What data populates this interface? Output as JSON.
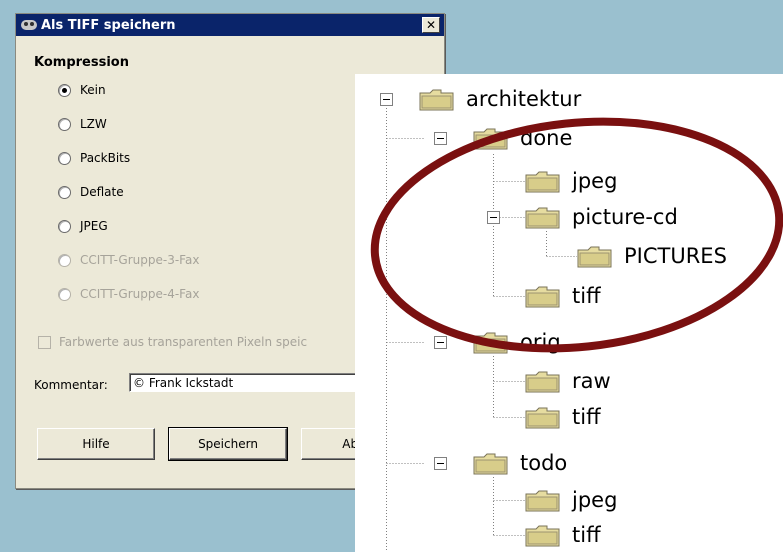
{
  "dialog": {
    "title": "Als TIFF speichern",
    "close_glyph": "✕",
    "section_title": "Kompression",
    "options": [
      {
        "label": "Kein",
        "checked": true,
        "enabled": true
      },
      {
        "label": "LZW",
        "checked": false,
        "enabled": true
      },
      {
        "label": "PackBits",
        "checked": false,
        "enabled": true
      },
      {
        "label": "Deflate",
        "checked": false,
        "enabled": true
      },
      {
        "label": "JPEG",
        "checked": false,
        "enabled": true
      },
      {
        "label": "CCITT-Gruppe-3-Fax",
        "checked": false,
        "enabled": false
      },
      {
        "label": "CCITT-Gruppe-4-Fax",
        "checked": false,
        "enabled": false
      }
    ],
    "checkbox_label": "Farbwerte aus transparenten Pixeln speic",
    "comment_label": "Kommentar:",
    "comment_value": "© Frank Ickstadt",
    "buttons": {
      "help": "Hilfe",
      "save": "Speichern",
      "cancel": "Abbre"
    }
  },
  "tree": {
    "nodes": [
      {
        "label": "architektur",
        "level": 0,
        "expandable": true
      },
      {
        "label": "done",
        "level": 1,
        "expandable": true
      },
      {
        "label": "jpeg",
        "level": 2,
        "expandable": false
      },
      {
        "label": "picture-cd",
        "level": 2,
        "expandable": true
      },
      {
        "label": "PICTURES",
        "level": 3,
        "expandable": false
      },
      {
        "label": "tiff",
        "level": 2,
        "expandable": false
      },
      {
        "label": "orig",
        "level": 1,
        "expandable": true
      },
      {
        "label": "raw",
        "level": 2,
        "expandable": false
      },
      {
        "label": "tiff",
        "level": 2,
        "expandable": false
      },
      {
        "label": "todo",
        "level": 1,
        "expandable": true
      },
      {
        "label": "jpeg",
        "level": 2,
        "expandable": false
      },
      {
        "label": "tiff",
        "level": 2,
        "expandable": false
      }
    ]
  },
  "colors": {
    "background": "#9ac0cf",
    "titlebar": "#0a246a",
    "annotation": "#7a1010",
    "folder": "#e6dca0"
  }
}
